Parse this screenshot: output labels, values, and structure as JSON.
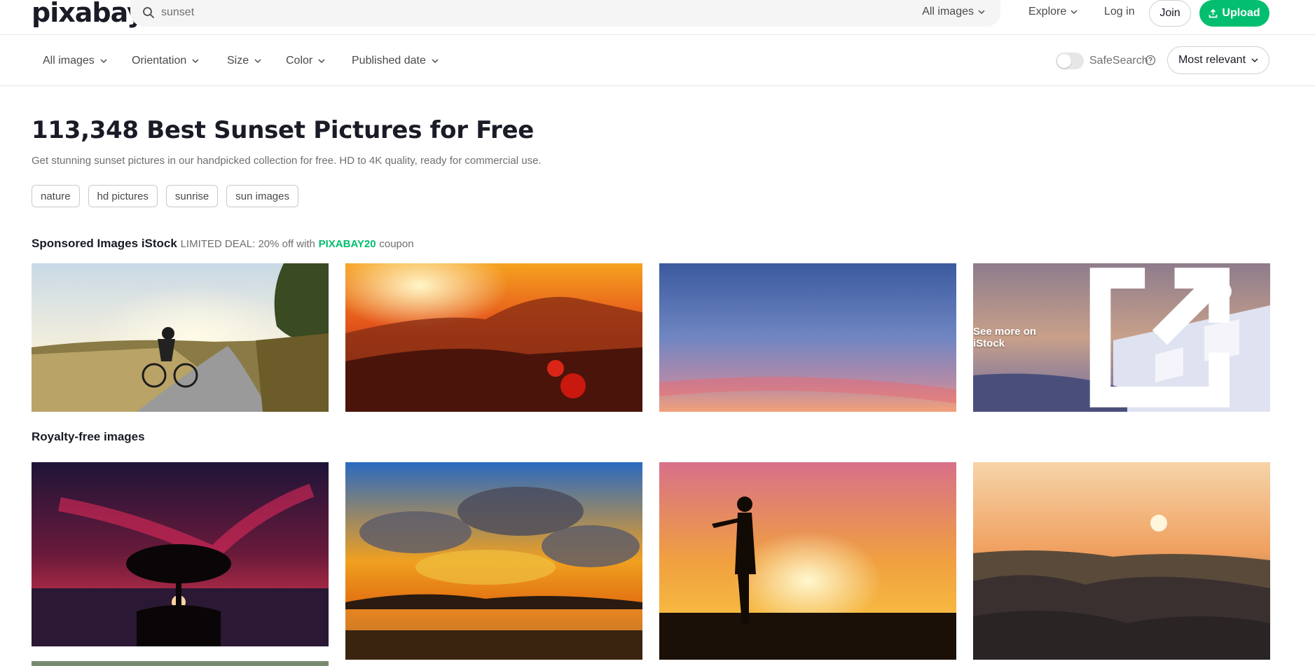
{
  "header": {
    "logo": "pixabay",
    "search_value": "sunset",
    "search_type": "All images",
    "explore": "Explore",
    "login": "Log in",
    "join": "Join",
    "upload": "Upload"
  },
  "filters": {
    "items": [
      "All images",
      "Orientation",
      "Size",
      "Color",
      "Published date"
    ],
    "safesearch": "SafeSearch",
    "sort": "Most relevant"
  },
  "page": {
    "title": "113,348 Best Sunset Pictures for Free",
    "description": "Get stunning sunset pictures in our handpicked collection for free. HD to 4K quality, ready for commercial use.",
    "tags": [
      "nature",
      "hd pictures",
      "sunrise",
      "sun images"
    ]
  },
  "sponsored": {
    "title": "Sponsored Images iStock",
    "deal": "LIMITED DEAL: 20% off with",
    "code": "PIXABAY20",
    "suffix": "coupon",
    "see_more": "See more on iStock"
  },
  "royalty": {
    "title": "Royalty-free images"
  },
  "colors": {
    "accent": "#02be6e",
    "text": "#191b26",
    "muted": "#6f6f6f"
  }
}
